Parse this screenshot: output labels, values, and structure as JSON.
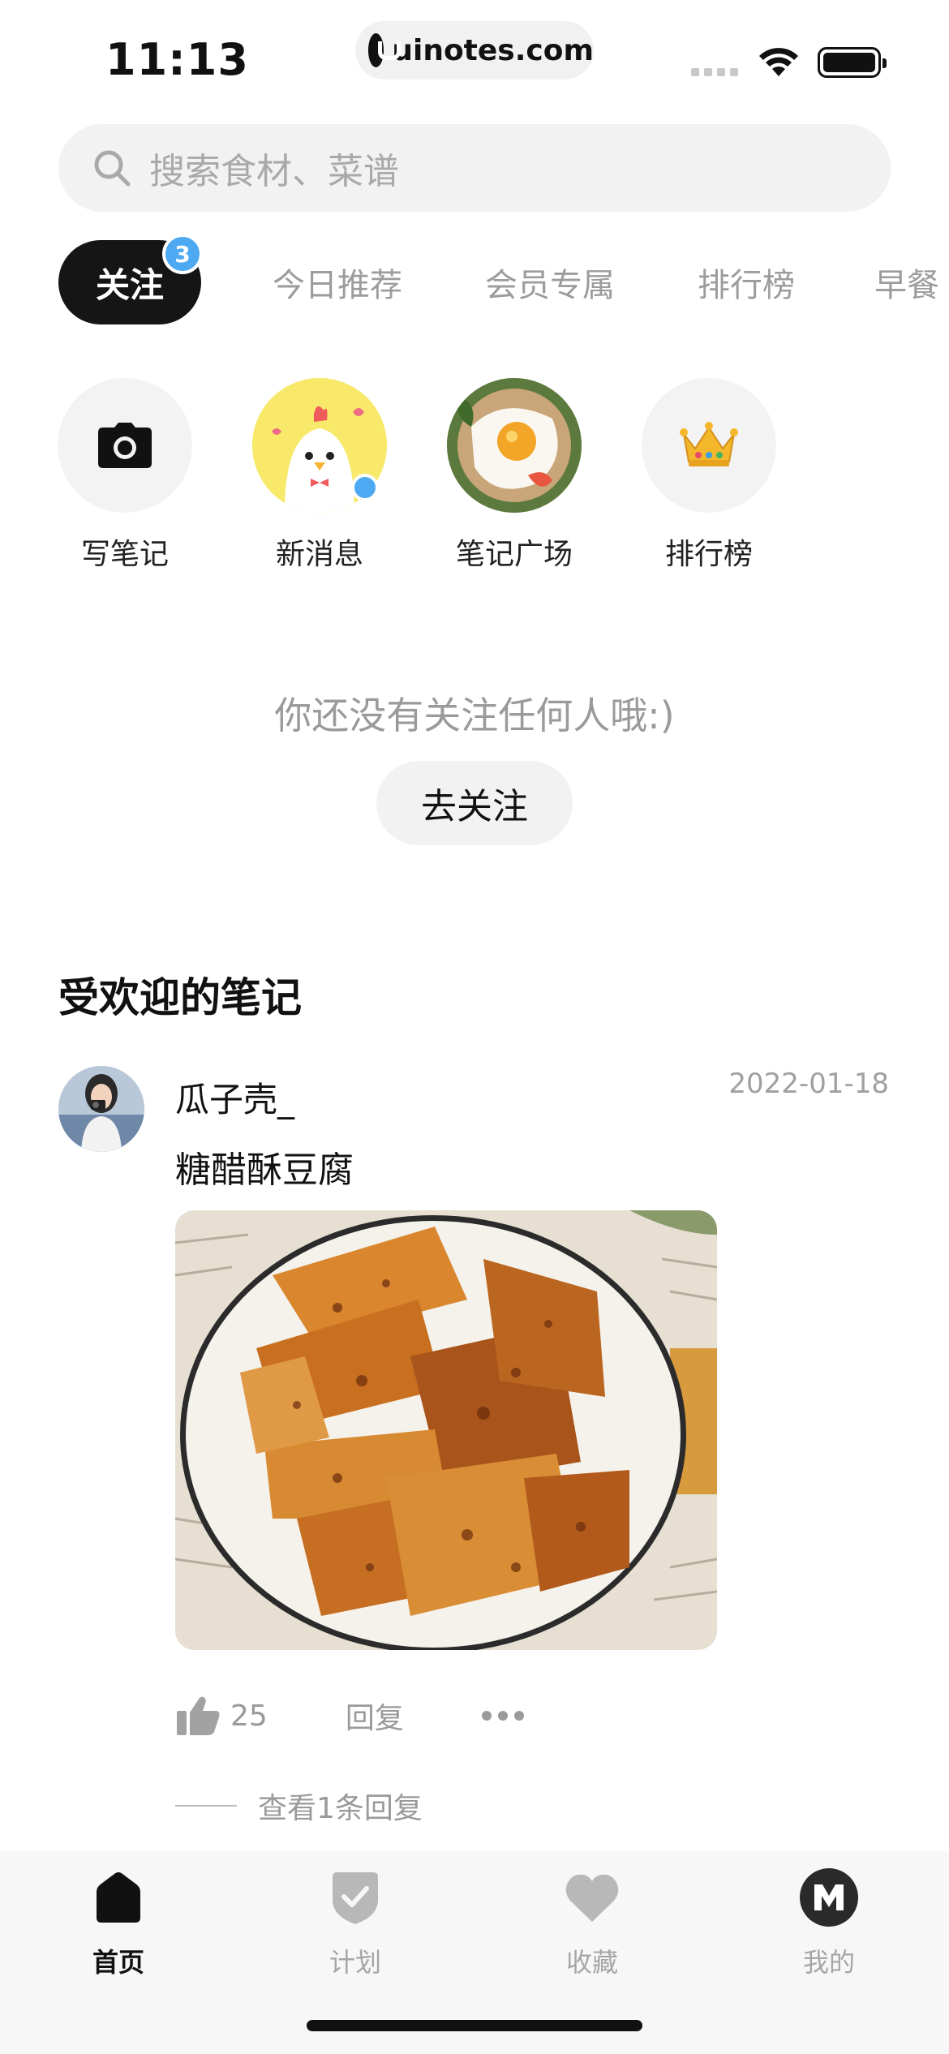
{
  "status_bar": {
    "time": "11:13",
    "url": "uinotes.com"
  },
  "search": {
    "placeholder": "搜索食材、菜谱"
  },
  "tabs": [
    {
      "label": "关注",
      "active": true,
      "badge": "3"
    },
    {
      "label": "今日推荐"
    },
    {
      "label": "会员专属"
    },
    {
      "label": "排行榜"
    },
    {
      "label": "早餐"
    }
  ],
  "quick_actions": [
    {
      "label": "写笔记",
      "icon": "camera-icon"
    },
    {
      "label": "新消息",
      "icon": "chick-avatar"
    },
    {
      "label": "笔记广场",
      "icon": "fried-egg-photo"
    },
    {
      "label": "排行榜",
      "icon": "crown-icon"
    }
  ],
  "follow_empty": {
    "message": "你还没有关注任何人哦:)",
    "button": "去关注"
  },
  "popular": {
    "title": "受欢迎的笔记",
    "post": {
      "author": "瓜子壳_",
      "date": "2022-01-18",
      "title": "糖醋酥豆腐",
      "likes": "25",
      "reply_label": "回复",
      "view_replies": "查看1条回复"
    }
  },
  "tabbar": [
    {
      "label": "首页",
      "icon": "home-icon",
      "active": true
    },
    {
      "label": "计划",
      "icon": "plan-shield-icon"
    },
    {
      "label": "收藏",
      "icon": "heart-icon"
    },
    {
      "label": "我的",
      "icon": "profile-m-icon"
    }
  ],
  "colors": {
    "accent_blue": "#4ea9f3",
    "active_tab": "#151515",
    "muted_text": "#9a9a9a"
  }
}
